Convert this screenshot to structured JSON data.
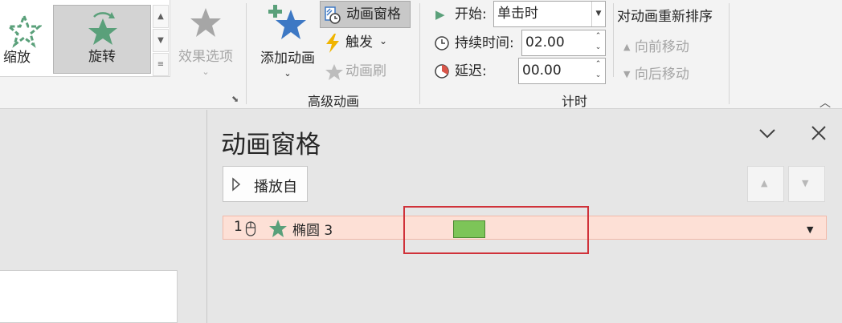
{
  "ribbon": {
    "gallery": {
      "items": [
        {
          "label": "缩放"
        },
        {
          "label": "旋转"
        }
      ]
    },
    "effect_options": {
      "label": "效果选项"
    },
    "advanced": {
      "add_animation": "添加动画",
      "animation_pane": "动画窗格",
      "trigger": "触发",
      "animation_painter": "动画刷",
      "group_label": "高级动画"
    },
    "timing": {
      "start_label": "开始:",
      "start_value": "单击时",
      "duration_label": "持续时间:",
      "duration_value": "02.00",
      "delay_label": "延迟:",
      "delay_value": "00.00",
      "reorder_title": "对动画重新排序",
      "move_earlier": "向前移动",
      "move_later": "向后移动",
      "group_label": "计时"
    }
  },
  "pane": {
    "title": "动画窗格",
    "play_from": "播放自",
    "items": [
      {
        "index": "1",
        "name": "椭圆 3",
        "bar_color": "#7dc558"
      }
    ]
  },
  "colors": {
    "accent_green": "#5aa07a",
    "highlight_red": "#d0323a",
    "row_bg": "#fde0d6"
  }
}
